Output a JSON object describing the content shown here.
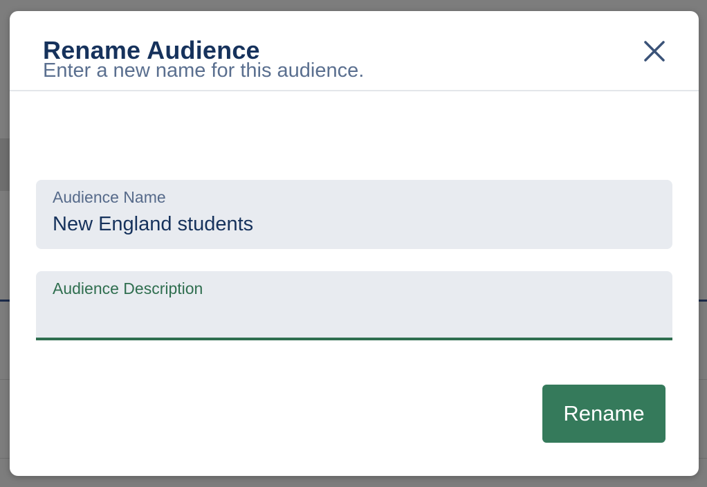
{
  "dialog": {
    "title": "Rename Audience",
    "intro": "Enter a new name for this audience.",
    "close_icon": "close-icon"
  },
  "fields": {
    "name": {
      "label": "Audience Name",
      "value": "New England students"
    },
    "description": {
      "label": "Audience Description",
      "value": ""
    }
  },
  "actions": {
    "rename_label": "Rename"
  },
  "colors": {
    "title": "#16325c",
    "accent": "#357a5b",
    "focus_border": "#2f6e4f",
    "field_bg": "#e8ebf0",
    "overlay": "#7d7d7d"
  }
}
